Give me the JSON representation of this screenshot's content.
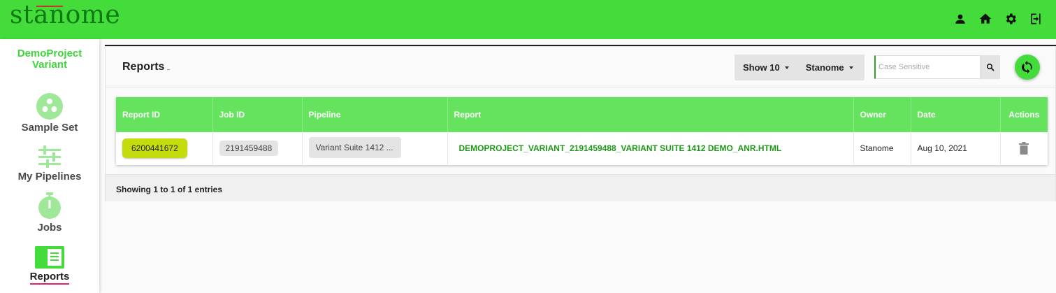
{
  "header": {
    "logo_text": "stanome",
    "icons": [
      "person-icon",
      "home-icon",
      "gear-icon",
      "logout-icon"
    ]
  },
  "sidebar": {
    "project_name": "DemoProject Variant",
    "items": [
      {
        "label": "Sample Set",
        "icon": "sample-set-icon"
      },
      {
        "label": "My Pipelines",
        "icon": "sliders-icon"
      },
      {
        "label": "Jobs",
        "icon": "stopwatch-icon"
      },
      {
        "label": "Reports",
        "icon": "report-icon",
        "active": true
      }
    ]
  },
  "main": {
    "title": "Reports",
    "show_label": "Show 10",
    "owner_filter_label": "Stanome",
    "search_placeholder": "Case Sensitive",
    "table": {
      "columns": [
        "Report ID",
        "Job ID",
        "Pipeline",
        "Report",
        "Owner",
        "Date",
        "Actions"
      ],
      "rows": [
        {
          "report_id": "6200441672",
          "job_id": "2191459488",
          "pipeline": "Variant Suite 1412 ...",
          "report": "DEMOPROJECT_VARIANT_2191459488_VARIANT SUITE 1412 DEMO_ANR.HTML",
          "owner": "Stanome",
          "date": "Aug 10, 2021"
        }
      ]
    },
    "footer": "Showing 1 to 1 of 1 entries"
  },
  "colors": {
    "brand_green": "#43dc3b",
    "logo_green": "#0e7a12",
    "table_header": "#66e35e",
    "report_id_pill": "#c4dc0b",
    "active_underline": "#e0245e"
  }
}
